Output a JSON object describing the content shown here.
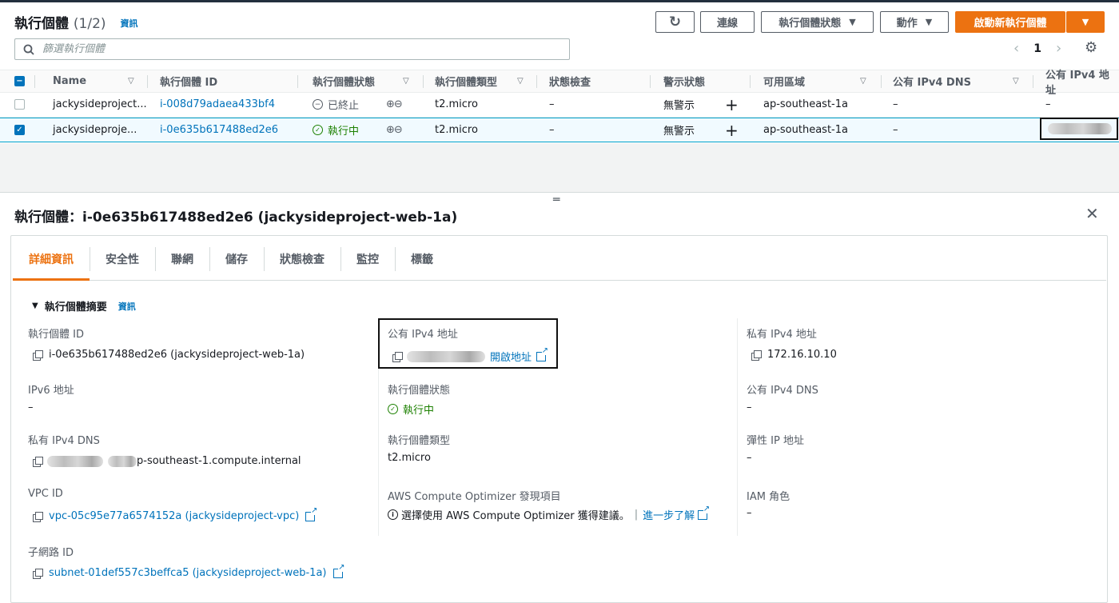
{
  "header": {
    "title": "執行個體",
    "count": "(1/2)",
    "info": "資訊",
    "buttons": {
      "refresh": "↻",
      "connect": "連線",
      "state": "執行個體狀態",
      "actions": "動作",
      "launch": "啟動新執行個體"
    },
    "search_placeholder": "篩選執行個體",
    "page": "1"
  },
  "table": {
    "columns": [
      "Name",
      "執行個體 ID",
      "執行個體狀態",
      "執行個體類型",
      "狀態檢查",
      "警示狀態",
      "可用區域",
      "公有 IPv4 DNS",
      "公有 IPv4 地址"
    ],
    "rows": [
      {
        "name": "jackysideproject...",
        "id": "i-008d79adaea433bf4",
        "state": "已終止",
        "type": "t2.micro",
        "status_check": "–",
        "alarm": "無警示",
        "az": "ap-southeast-1a",
        "dns": "–",
        "ip": "–",
        "selected": false
      },
      {
        "name": "jackysideproje...",
        "id": "i-0e635b617488ed2e6",
        "state": "執行中",
        "type": "t2.micro",
        "status_check": "–",
        "alarm": "無警示",
        "az": "ap-southeast-1a",
        "dns": "–",
        "ip": "",
        "selected": true
      }
    ]
  },
  "detail": {
    "title": "執行個體：i-0e635b617488ed2e6 (jackysideproject-web-1a)",
    "tabs": [
      "詳細資訊",
      "安全性",
      "聯網",
      "儲存",
      "狀態檢查",
      "監控",
      "標籤"
    ],
    "active_tab": 0,
    "section": "執行個體摘要",
    "section_info": "資訊",
    "instance_id_label": "執行個體 ID",
    "instance_id": "i-0e635b617488ed2e6 (jackysideproject-web-1a)",
    "ipv6_label": "IPv6 地址",
    "ipv6": "–",
    "private_dns_label": "私有 IPv4 DNS",
    "private_dns_suffix": "p-southeast-1.compute.internal",
    "vpc_label": "VPC ID",
    "vpc": "vpc-05c95e77a6574152a (jackysideproject-vpc)",
    "subnet_label": "子網路 ID",
    "subnet": "subnet-01def557c3beffca5 (jackysideproject-web-1a)",
    "public_ip_label": "公有 IPv4 地址",
    "open_address": "開啟地址",
    "state_label": "執行個體狀態",
    "state": "執行中",
    "type_label": "執行個體類型",
    "type": "t2.micro",
    "optimizer_label": "AWS Compute Optimizer 發現項目",
    "optimizer_text": "選擇使用 AWS Compute Optimizer 獲得建議。",
    "optimizer_sep": "|",
    "optimizer_link": "進一步了解",
    "private_ip_label": "私有 IPv4 地址",
    "private_ip": "172.16.10.10",
    "public_dns_label": "公有 IPv4 DNS",
    "public_dns": "–",
    "elastic_label": "彈性 IP 地址",
    "elastic": "–",
    "iam_label": "IAM 角色",
    "iam": "–"
  }
}
